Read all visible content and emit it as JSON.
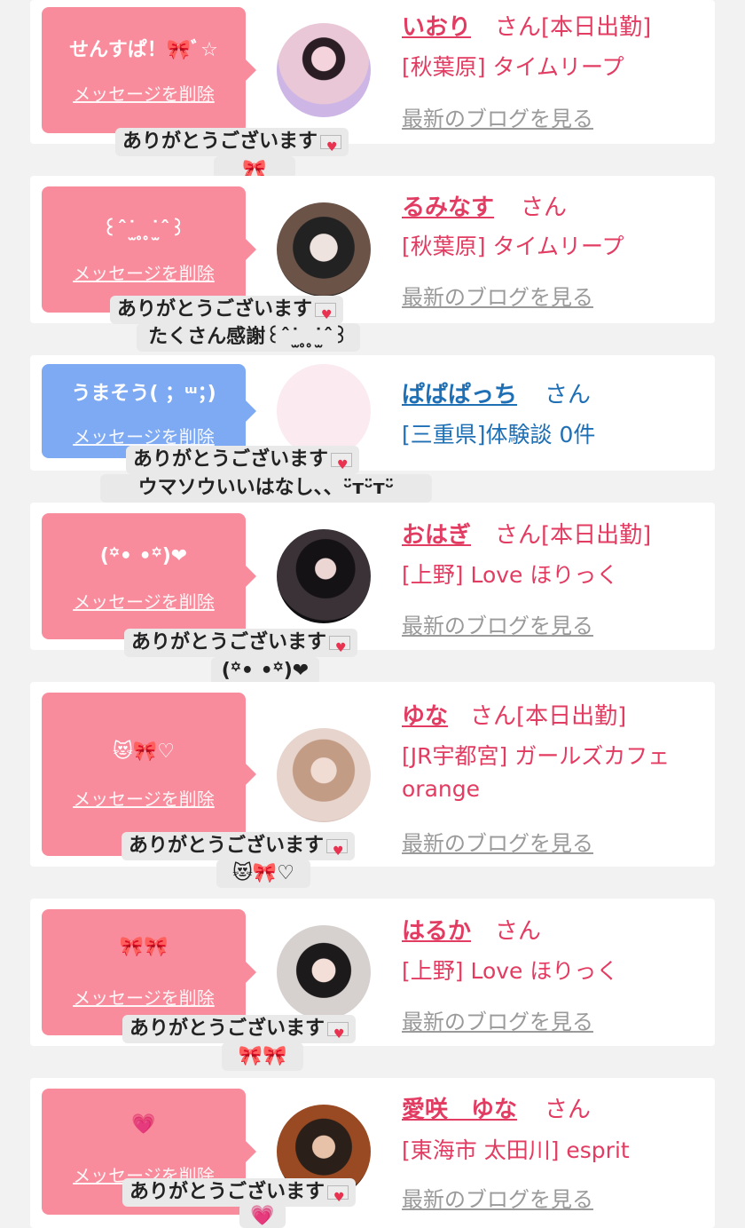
{
  "shared": {
    "delete_label": "メッセージを削除",
    "blog_label": "最新のブログを見る",
    "thanks_text": "ありがとうございます",
    "san": "さん",
    "on_duty": "[本日出勤]"
  },
  "cards": [
    {
      "bubble_text": "せんすぱ！🎀ﾞ☆",
      "bubble_color": "pink",
      "name": "いおり",
      "on_duty": true,
      "shop": "[秋葉原] タイムリープ",
      "shop_line2": "",
      "blog": true,
      "reply_line2": "🎀",
      "avatar": "photo"
    },
    {
      "bubble_text": "꒰ˆ˙̫ ̥ ̥˙̫ˆ꒱",
      "bubble_color": "pink",
      "name": "るみなす",
      "on_duty": false,
      "shop": "[秋葉原] タイムリープ",
      "shop_line2": "",
      "blog": true,
      "reply_line2": "たくさん感謝꒰ˆ˙̫ ̥ ̥˙̫ˆ꒱",
      "avatar": "photo"
    },
    {
      "bubble_text": "うまそう( ；ᵚ；)",
      "bubble_color": "blue",
      "name": "ぱぱぱっち",
      "on_duty": false,
      "shop": "[三重県]体験談 0件",
      "shop_line2": "",
      "blog": false,
      "reply_line2": "ウマソウいいはなし、、ᵕ̈ᴛᵕ̈ᴛᵕ̈",
      "avatar": "blank"
    },
    {
      "bubble_text": "(꙳• •꙳)❤",
      "bubble_color": "pink",
      "name": "おはぎ",
      "on_duty": true,
      "shop": "[上野] Love ほりっく",
      "shop_line2": "",
      "blog": true,
      "reply_line2": "(꙳• •꙳)❤",
      "avatar": "photo"
    },
    {
      "bubble_text": "😻🎀♡",
      "bubble_color": "pink",
      "name": "ゆな",
      "on_duty": true,
      "shop": "[JR宇都宮] ガールズカフェ",
      "shop_line2": "orange",
      "blog": true,
      "reply_line2": "😻🎀♡",
      "avatar": "photo"
    },
    {
      "bubble_text": "🎀🎀",
      "bubble_color": "pink",
      "name": "はるか",
      "on_duty": false,
      "shop": "[上野] Love ほりっく",
      "shop_line2": "",
      "blog": true,
      "reply_line2": "🎀🎀",
      "avatar": "photo"
    },
    {
      "bubble_text": "💗",
      "bubble_color": "pink",
      "name": "愛咲　ゆな",
      "on_duty": false,
      "shop": "[東海市 太田川] esprit",
      "shop_line2": "",
      "blog": true,
      "reply_line2": "💗",
      "avatar": "photo"
    }
  ]
}
